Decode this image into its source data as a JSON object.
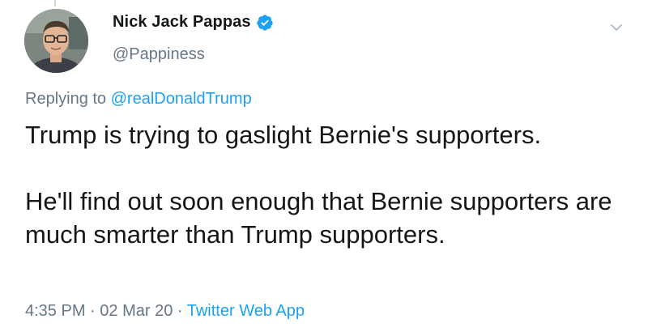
{
  "tweet": {
    "author": {
      "display_name": "Nick Jack Pappas",
      "handle": "@Pappiness",
      "verified_icon": "verified-badge-icon"
    },
    "reply_prefix": "Replying to",
    "reply_to": "@realDonaldTrump",
    "paragraphs": [
      "Trump is trying to gaslight Bernie's supporters.",
      "He'll find out soon enough that Bernie supporters are much smarter than Trump supporters."
    ],
    "time": "4:35 PM",
    "sep1": " · ",
    "date": "02 Mar 20",
    "sep2": " · ",
    "source": "Twitter Web App"
  },
  "colors": {
    "text": "#14171a",
    "secondary": "#657786",
    "link": "#1da1f2"
  }
}
